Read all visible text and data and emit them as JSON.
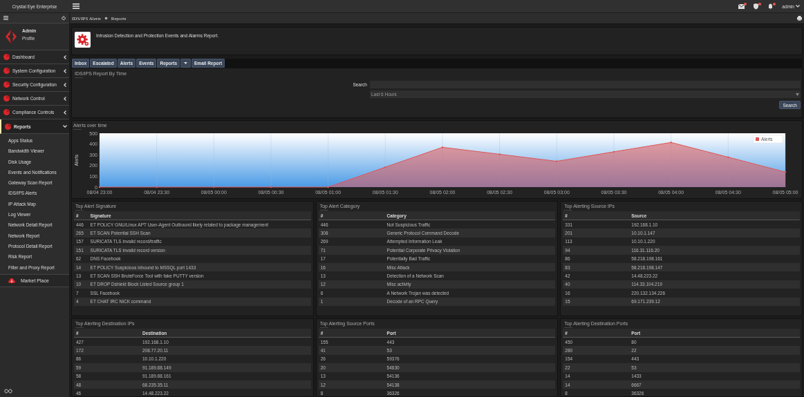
{
  "topbar": {
    "brand": "Crystal Eye Enterprise",
    "user": "admin"
  },
  "sidebar": {
    "profile": {
      "name": "Admin",
      "link": "Profile"
    },
    "items": [
      {
        "label": "Dashboard",
        "expanded": false,
        "selected": false
      },
      {
        "label": "System Configuration",
        "expanded": false,
        "selected": false
      },
      {
        "label": "Security Configuration",
        "expanded": false,
        "selected": false
      },
      {
        "label": "Network Control",
        "expanded": false,
        "selected": false
      },
      {
        "label": "Compliance Controls",
        "expanded": false,
        "selected": false
      },
      {
        "label": "Reports",
        "expanded": true,
        "selected": true,
        "children": [
          "Apps Status",
          "Bandwidth Viewer",
          "Disk Usage",
          "Events and Notifications",
          "Gateway Scan Report",
          "IDS/IPS Alerts",
          "IP Attack Map",
          "Log Viewer",
          "Network Detail Report",
          "Network Report",
          "Protocol Detail Report",
          "Risk Report",
          "Filter and Proxy Report"
        ]
      }
    ],
    "market": "Market Place"
  },
  "breadcrumb": [
    "IDS/IPS Alerts",
    "Reports"
  ],
  "header": {
    "description": "Intrusion Detection and Protection Events and Alarms Report."
  },
  "tabs": [
    {
      "label": "Inbox",
      "selected": false
    },
    {
      "label": "Escalated",
      "selected": false
    },
    {
      "label": "Alerts",
      "selected": false
    },
    {
      "label": "Events",
      "selected": false
    },
    {
      "label": "Reports",
      "selected": false,
      "dropdown": true
    },
    {
      "label": "Email Report",
      "selected": false
    }
  ],
  "filter": {
    "title": "IDS/IPS Report By Time",
    "search_label": "Search",
    "range": "Last 6 Hours",
    "button": "Search"
  },
  "chart": {
    "title": "Alerts over time",
    "chart_data": {
      "type": "area",
      "ylabel": "Alerts",
      "categories": [
        "08/04 23:00",
        "08/04 23:30",
        "08/05 00:00",
        "08/05 00:30",
        "08/05 01:00",
        "08/05 01:30",
        "08/05 02:00",
        "08/05 02:30",
        "08/05 03:00",
        "08/05 03:30",
        "08/05 04:00",
        "08/05 04:30",
        "08/05 05:00"
      ],
      "series": [
        {
          "name": "Alerts",
          "color": "#e05555",
          "values": [
            0,
            0,
            0,
            0,
            0,
            185,
            370,
            305,
            240,
            328,
            415,
            278,
            140
          ]
        }
      ],
      "ylim": [
        0,
        500
      ],
      "grid": true,
      "yticks": [
        0,
        100,
        200,
        300,
        400,
        500
      ]
    }
  },
  "tables": [
    {
      "title": "Top Alert Signature",
      "columns": [
        "#",
        "Signature"
      ],
      "rows": [
        [
          "446",
          "ET POLICY GNU/Linux APT User-Agent Outbound likely related to package management"
        ],
        [
          "265",
          "ET SCAN Potential SSH Scan"
        ],
        [
          "157",
          "SURICATA TLS invalid record/traffic"
        ],
        [
          "151",
          "SURICATA TLS invalid record version"
        ],
        [
          "62",
          "DNS Facebook"
        ],
        [
          "14",
          "ET POLICY Suspicious inbound to MSSQL port 1433"
        ],
        [
          "13",
          "ET SCAN SSH BruteForce Tool with fake PUTTY version"
        ],
        [
          "10",
          "ET DROP Dshield Block Listed Source group 1"
        ],
        [
          "7",
          "SSL Facebook"
        ],
        [
          "4",
          "ET CHAT IRC NICK command"
        ]
      ]
    },
    {
      "title": "Top Alert Category",
      "columns": [
        "#",
        "Category"
      ],
      "rows": [
        [
          "446",
          "Not Suspicious Traffic"
        ],
        [
          "308",
          "Generic Protocol Command Decode"
        ],
        [
          "269",
          "Attempted Information Leak"
        ],
        [
          "71",
          "Potential Corporate Privacy Violation"
        ],
        [
          "17",
          "Potentially Bad Traffic"
        ],
        [
          "16",
          "Misc Attack"
        ],
        [
          "13",
          "Detection of a Network Scan"
        ],
        [
          "12",
          "Misc activity"
        ],
        [
          "6",
          "A Network Trojan was detected"
        ],
        [
          "1",
          "Decode of an RPC Query"
        ]
      ]
    },
    {
      "title": "Top Alerting Source IPs",
      "columns": [
        "#",
        "Source"
      ],
      "rows": [
        [
          "331",
          "192.168.1.10"
        ],
        [
          "201",
          "10.10.1.147"
        ],
        [
          "113",
          "10.10.1.220"
        ],
        [
          "94",
          "116.31.116.20"
        ],
        [
          "86",
          "58.218.198.161"
        ],
        [
          "83",
          "58.218.198.147"
        ],
        [
          "42",
          "14.48.223.22"
        ],
        [
          "40",
          "114.33.104.219"
        ],
        [
          "16",
          "220.132.134.226"
        ],
        [
          "15",
          "69.171.239.12"
        ]
      ]
    },
    {
      "title": "Top Alerting Destination IPs",
      "columns": [
        "#",
        "Destination"
      ],
      "rows": [
        [
          "427",
          "192.168.1.10"
        ],
        [
          "172",
          "208.77.20.11"
        ],
        [
          "86",
          "10.10.1.220"
        ],
        [
          "59",
          "91.189.88.149"
        ],
        [
          "58",
          "91.189.88.161"
        ],
        [
          "48",
          "68.235.35.11"
        ],
        [
          "46",
          "14.48.223.22"
        ]
      ]
    },
    {
      "title": "Top Alerting Source Ports",
      "columns": [
        "#",
        "Port"
      ],
      "rows": [
        [
          "155",
          "443"
        ],
        [
          "41",
          "53"
        ],
        [
          "26",
          "59376"
        ],
        [
          "20",
          "54630"
        ],
        [
          "13",
          "54136"
        ],
        [
          "12",
          "54138"
        ],
        [
          "8",
          "36326"
        ]
      ]
    },
    {
      "title": "Top Alerting Destination Ports",
      "columns": [
        "#",
        "Port"
      ],
      "rows": [
        [
          "450",
          "80"
        ],
        [
          "280",
          "22"
        ],
        [
          "154",
          "443"
        ],
        [
          "22",
          "53"
        ],
        [
          "14",
          "1433"
        ],
        [
          "14",
          "6667"
        ],
        [
          "8",
          "36326"
        ]
      ]
    }
  ]
}
